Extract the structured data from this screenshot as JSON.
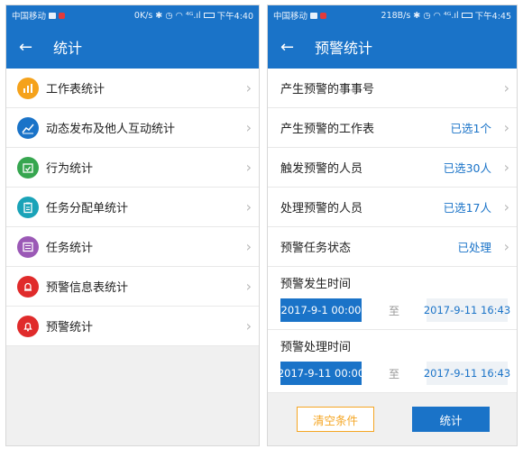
{
  "left_status": {
    "carrier": "中国移动",
    "speed": "0K/s",
    "signal": "⁴ᴳ.ıl",
    "time": "下午4:40"
  },
  "right_status": {
    "carrier": "中国移动",
    "speed": "218B/s",
    "signal": "⁴ᴳ.ıl",
    "time": "下午4:45"
  },
  "left_header": {
    "back": "←",
    "title": "统计"
  },
  "right_header": {
    "back": "←",
    "title": "预警统计"
  },
  "stat_menu": [
    {
      "label": "工作表统计",
      "icon": "bar-chart-icon",
      "color": "#f5a21b"
    },
    {
      "label": "动态发布及他人互动统计",
      "icon": "line-chart-icon",
      "color": "#1a73c8"
    },
    {
      "label": "行为统计",
      "icon": "calendar-check-icon",
      "color": "#36a64f"
    },
    {
      "label": "任务分配单统计",
      "icon": "clipboard-icon",
      "color": "#1aa3b8"
    },
    {
      "label": "任务统计",
      "icon": "list-icon",
      "color": "#9b59b6"
    },
    {
      "label": "预警信息表统计",
      "icon": "alarm-icon",
      "color": "#e02b2b"
    },
    {
      "label": "预警统计",
      "icon": "bell-icon",
      "color": "#e02b2b"
    }
  ],
  "filters": [
    {
      "label": "产生预警的事事号",
      "value": ""
    },
    {
      "label": "产生预警的工作表",
      "value": "已选1个"
    },
    {
      "label": "触发预警的人员",
      "value": "已选30人"
    },
    {
      "label": "处理预警的人员",
      "value": "已选17人"
    },
    {
      "label": "预警任务状态",
      "value": "已处理"
    }
  ],
  "time_ranges": [
    {
      "label": "预警发生时间",
      "start": "2017-9-1 00:00",
      "sep": "至",
      "end": "2017-9-11 16:43"
    },
    {
      "label": "预警处理时间",
      "start": "2017-9-11 00:00",
      "sep": "至",
      "end": "2017-9-11 16:43"
    }
  ],
  "chevron": "›",
  "buttons": {
    "clear": "清空条件",
    "stat": "统计"
  }
}
